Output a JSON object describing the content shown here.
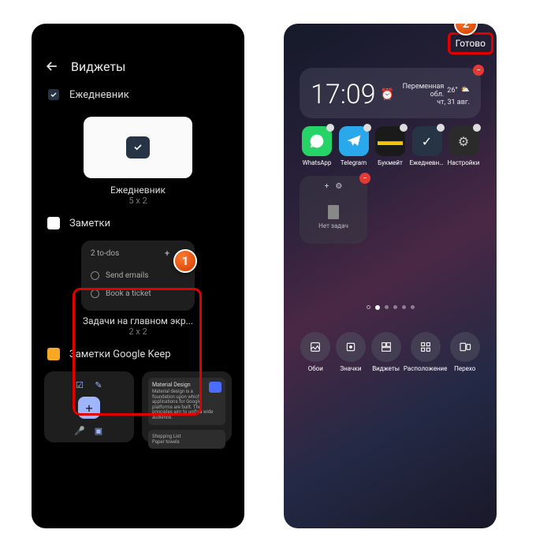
{
  "left": {
    "title": "Виджеты",
    "section1": "Ежедневник",
    "planner_label": "Ежедневник",
    "planner_dim": "5 x 2",
    "section2": "Заметки",
    "todo_count": "2 to-dos",
    "todo1": "Send emails",
    "todo2": "Book a ticket",
    "todo_label": "Задачи на главном экр...",
    "todo_dim": "2 x 2",
    "section3": "Заметки Google Keep",
    "keep_note_title": "Material Design",
    "keep_note_body": "Material design is a foundation upon which applications for Google platforms are built. The principles aim to unify a wide audience.",
    "keep_note2": "Shopping List",
    "keep_note3": "Paper towels"
  },
  "right": {
    "done": "Готово",
    "time": "17:09",
    "weather_desc": "Переменная обл.",
    "weather_temp": "26°",
    "date": "чт, 31 авг.",
    "apps": {
      "whatsapp": "WhatsApp",
      "telegram": "Telegram",
      "bookmate": "Букмейт",
      "planner": "Ежедневн...",
      "settings": "Настройки"
    },
    "mini_widget_text": "Нет задач",
    "bottom": {
      "wallpaper": "Обои",
      "icons": "Значки",
      "widgets": "Виджеты",
      "layout": "Расположение",
      "transition": "Перехо"
    }
  },
  "callouts": {
    "one": "1",
    "two": "2"
  }
}
